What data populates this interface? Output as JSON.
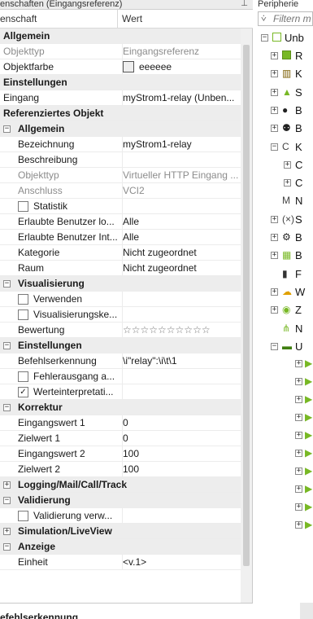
{
  "props": {
    "title": "enschaften (Eingangsreferenz)",
    "pin": "⊥",
    "col_name": "enschaft",
    "col_value": "Wert"
  },
  "rows": [
    {
      "kind": "section",
      "name": "Allgemein"
    },
    {
      "kind": "row",
      "name": "Objekttyp",
      "value": "Eingangsreferenz",
      "grey": true
    },
    {
      "kind": "row",
      "name": "Objektfarbe",
      "value": "eeeeee",
      "swatch": true
    },
    {
      "kind": "section",
      "name": "Einstellungen"
    },
    {
      "kind": "row",
      "name": "Eingang",
      "value": "myStrom1-relay (Unben..."
    },
    {
      "kind": "section",
      "name": "Referenziertes Objekt"
    },
    {
      "kind": "subsection",
      "name": "Allgemein",
      "exp": "−"
    },
    {
      "kind": "row",
      "indent": 1,
      "name": "Bezeichnung",
      "value": "myStrom1-relay"
    },
    {
      "kind": "row",
      "indent": 1,
      "name": "Beschreibung",
      "value": ""
    },
    {
      "kind": "row",
      "indent": 1,
      "name": "Objekttyp",
      "value": "Virtueller HTTP Eingang ...",
      "grey": true
    },
    {
      "kind": "row",
      "indent": 1,
      "name": "Anschluss",
      "value": "VCI2",
      "grey": true
    },
    {
      "kind": "check",
      "indent": 1,
      "name": "Statistik",
      "checked": false,
      "value": ""
    },
    {
      "kind": "row",
      "indent": 1,
      "name": "Erlaubte Benutzer lo...",
      "value": "Alle"
    },
    {
      "kind": "row",
      "indent": 1,
      "name": "Erlaubte Benutzer Int...",
      "value": "Alle"
    },
    {
      "kind": "row",
      "indent": 1,
      "name": "Kategorie",
      "value": "Nicht zugeordnet"
    },
    {
      "kind": "row",
      "indent": 1,
      "name": "Raum",
      "value": "Nicht zugeordnet"
    },
    {
      "kind": "subsection",
      "name": "Visualisierung",
      "exp": "−"
    },
    {
      "kind": "check",
      "indent": 1,
      "name": "Verwenden",
      "checked": false,
      "value": ""
    },
    {
      "kind": "check",
      "indent": 1,
      "name": "Visualisierungske...",
      "checked": false,
      "value": ""
    },
    {
      "kind": "row",
      "indent": 1,
      "name": "Bewertung",
      "value": "☆☆☆☆☆☆☆☆☆☆",
      "stars": true
    },
    {
      "kind": "subsection",
      "name": "Einstellungen",
      "exp": "−"
    },
    {
      "kind": "row",
      "indent": 1,
      "name": "Befehlserkennung",
      "value": "\\i\"relay\":\\i\\t\\1"
    },
    {
      "kind": "check",
      "indent": 1,
      "name": "Fehlerausgang a...",
      "checked": false,
      "value": ""
    },
    {
      "kind": "check",
      "indent": 1,
      "name": "Werteinterpretati...",
      "checked": true,
      "value": ""
    },
    {
      "kind": "subsection",
      "name": "Korrektur",
      "exp": "−"
    },
    {
      "kind": "row",
      "indent": 1,
      "name": "Eingangswert 1",
      "value": "0"
    },
    {
      "kind": "row",
      "indent": 1,
      "name": "Zielwert 1",
      "value": "0"
    },
    {
      "kind": "row",
      "indent": 1,
      "name": "Eingangswert 2",
      "value": "100"
    },
    {
      "kind": "row",
      "indent": 1,
      "name": "Zielwert 2",
      "value": "100"
    },
    {
      "kind": "subsection",
      "name": "Logging/Mail/Call/Track",
      "exp": "+"
    },
    {
      "kind": "subsection",
      "name": "Validierung",
      "exp": "−"
    },
    {
      "kind": "check",
      "indent": 1,
      "name": "Validierung verw...",
      "checked": false,
      "value": ""
    },
    {
      "kind": "subsection",
      "name": "Simulation/LiveView",
      "exp": "+"
    },
    {
      "kind": "subsection",
      "name": "Anzeige",
      "exp": "−"
    },
    {
      "kind": "row",
      "indent": 1,
      "name": "Einheit",
      "value": "<v.1>"
    }
  ],
  "description": {
    "heading": "efehlserkennung"
  },
  "peripherie": {
    "title": "Peripherie",
    "filter_placeholder": "Filtern m",
    "root_label": "Unb",
    "nodes": [
      {
        "label": "R",
        "icon": "green-square-icon",
        "exp": "+"
      },
      {
        "label": "K",
        "icon": "meter-icon",
        "exp": "+"
      },
      {
        "label": "S",
        "icon": "image-icon",
        "exp": "+"
      },
      {
        "label": "B",
        "icon": "user-icon",
        "exp": "+"
      },
      {
        "label": "B",
        "icon": "users-icon",
        "exp": "+"
      },
      {
        "label": "K",
        "icon": "c-icon",
        "exp": "−"
      },
      {
        "label": "C",
        "icon": "",
        "exp": "+"
      },
      {
        "label": "C",
        "icon": "",
        "exp": "+"
      },
      {
        "label": "N",
        "icon": "m-icon",
        "exp": ""
      },
      {
        "label": "S",
        "icon": "x-icon",
        "exp": "+"
      },
      {
        "label": "B",
        "icon": "gear-icon",
        "exp": "+"
      },
      {
        "label": "B",
        "icon": "calendar-icon",
        "exp": "+"
      },
      {
        "label": "F",
        "icon": "phone-icon",
        "exp": ""
      },
      {
        "label": "W",
        "icon": "weather-icon",
        "exp": "+"
      },
      {
        "label": "Z",
        "icon": "clock-icon",
        "exp": "+"
      },
      {
        "label": "N",
        "icon": "network-icon",
        "exp": ""
      },
      {
        "label": "U",
        "icon": "green-bar-icon",
        "exp": "−"
      }
    ]
  },
  "colors": {
    "accent_green": "#78b825",
    "section_bg": "#ededed",
    "swatch": "#eeeeee"
  }
}
